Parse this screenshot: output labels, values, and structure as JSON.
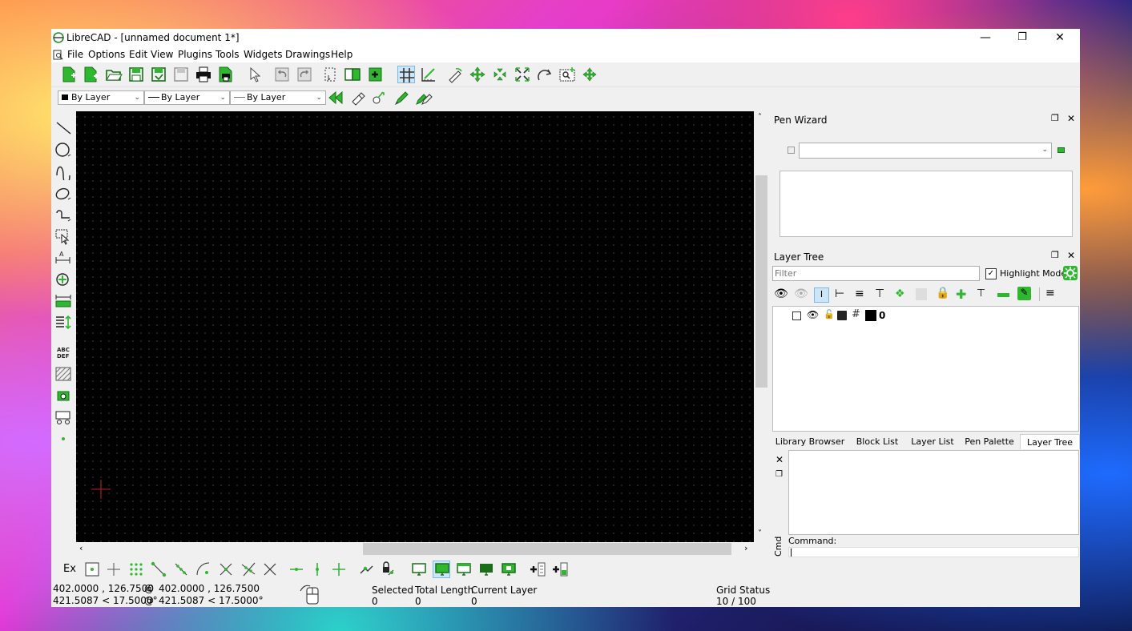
{
  "window": {
    "title": "LibreCAD - [unnamed document 1*]",
    "controls": {
      "minimize": "—",
      "restore": "❐",
      "close": "✕"
    }
  },
  "menu": {
    "items": [
      "File",
      "Options",
      "Edit",
      "View",
      "Plugins",
      "Tools",
      "Widgets",
      "Drawings",
      "Help"
    ]
  },
  "pen_toolbar": {
    "color": "By Layer",
    "width": "By Layer",
    "linetype": "By Layer"
  },
  "pen_wizard": {
    "title": "Pen Wizard",
    "combo_value": ""
  },
  "layer_tree": {
    "title": "Layer Tree",
    "filter_placeholder": "Filter",
    "highlight_mode_label": "Highlight Mode",
    "highlight_mode_checked": true,
    "layers": [
      {
        "name": "0",
        "visible": true,
        "locked": false,
        "printable": true,
        "color": "#000000"
      }
    ]
  },
  "dock_tabs": [
    "Library Browser",
    "Block List",
    "Layer List",
    "Pen Palette",
    "Layer Tree"
  ],
  "active_dock_tab": "Layer Tree",
  "command": {
    "side_label": "Cmd",
    "prompt_label": "Command:",
    "input_value": ""
  },
  "snap_toolbar": {
    "exclusive_label": "Ex"
  },
  "status": {
    "abs_coords": "402.0000 , 126.7500",
    "abs_polar": "421.5087 < 17.5000°",
    "rel_coords": "402.0000 , 126.7500",
    "rel_polar": "421.5087 < 17.5000°",
    "rel_prefix": "@",
    "selected_label": "Selected",
    "selected_value": "0",
    "total_length_label": "Total Length",
    "total_length_value": "0",
    "current_layer_label": "Current Layer",
    "current_layer_value": "0",
    "grid_status_label": "Grid Status",
    "grid_status_value": "10 / 100"
  },
  "colors": {
    "accent_green": "#2fb82f",
    "canvas_bg": "#000000",
    "grid_dot": "#3a3a3a",
    "cursor": "#c02020",
    "command_label": "#1f2fa0"
  }
}
